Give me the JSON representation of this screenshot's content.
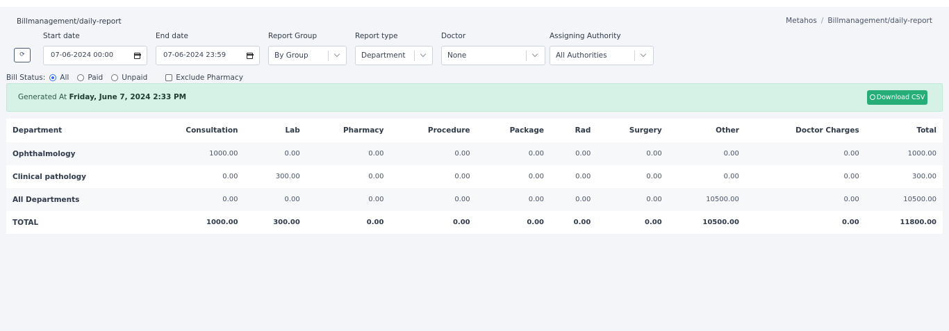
{
  "header": {
    "title": "Billmanagement/daily-report",
    "breadcrumb": [
      "Metahos",
      "/",
      "Billmanagement/daily-report"
    ]
  },
  "filters": {
    "refresh_icon": "refresh-icon",
    "refresh_glyph": "⟳",
    "start_date": {
      "label": "Start date",
      "value": "07-06-2024 00:00"
    },
    "end_date": {
      "label": "End date",
      "value": "07-06-2024 23:59"
    },
    "report_group": {
      "label": "Report Group",
      "value": "By Group"
    },
    "report_type": {
      "label": "Report type",
      "value": "Department"
    },
    "doctor": {
      "label": "Doctor",
      "value": "None"
    },
    "assigning_authority": {
      "label": "Assigning Authority",
      "value": "All Authorities"
    }
  },
  "bill_status": {
    "label": "Bill Status:",
    "options": [
      "All",
      "Paid",
      "Unpaid"
    ],
    "selected": "All",
    "exclude_pharmacy_label": "Exclude Pharmacy",
    "exclude_pharmacy_checked": false
  },
  "generated": {
    "prefix": "Generated At",
    "timestamp": "Friday, June 7, 2024 2:33 PM",
    "download_label": "Download CSV",
    "download_icon": "download-icon"
  },
  "table": {
    "columns": [
      "Department",
      "Consultation",
      "Lab",
      "Pharmacy",
      "Procedure",
      "Package",
      "Rad",
      "Surgery",
      "Other",
      "Doctor Charges",
      "Total"
    ],
    "rows": [
      [
        "Ophthalmology",
        "1000.00",
        "0.00",
        "0.00",
        "0.00",
        "0.00",
        "0.00",
        "0.00",
        "0.00",
        "0.00",
        "1000.00"
      ],
      [
        "Clinical pathology",
        "0.00",
        "300.00",
        "0.00",
        "0.00",
        "0.00",
        "0.00",
        "0.00",
        "0.00",
        "0.00",
        "300.00"
      ],
      [
        "All Departments",
        "0.00",
        "0.00",
        "0.00",
        "0.00",
        "0.00",
        "0.00",
        "0.00",
        "10500.00",
        "0.00",
        "10500.00"
      ],
      [
        "TOTAL",
        "1000.00",
        "300.00",
        "0.00",
        "0.00",
        "0.00",
        "0.00",
        "0.00",
        "10500.00",
        "0.00",
        "11800.00"
      ]
    ]
  },
  "colors": {
    "accent": "#27ae78",
    "generated_bg": "#d6f2e6",
    "radio_checked": "#2f6df6"
  }
}
